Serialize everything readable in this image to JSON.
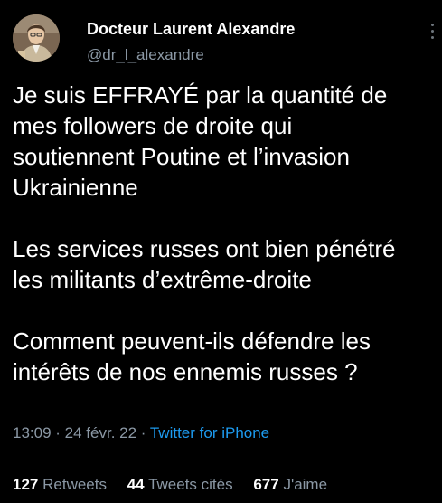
{
  "author": {
    "name": "Docteur Laurent Alexandre",
    "handle": "@dr_l_alexandre"
  },
  "tweet": {
    "paragraphs": [
      "Je suis EFFRAYÉ par la quantité de\nmes followers de droite qui\nsoutiennent Poutine et l’invasion\nUkrainienne",
      "Les services russes ont bien pénétré\nles militants d’extrême-droite",
      "Comment peuvent-ils défendre les\nintérêts de nos ennemis russes ?"
    ]
  },
  "meta": {
    "time": "13:09",
    "sep1": " · ",
    "date": "24 févr. 22",
    "sep2": " · ",
    "source": "Twitter for iPhone"
  },
  "stats": {
    "retweets_count": "127",
    "retweets_label": "Retweets",
    "quotes_count": "44",
    "quotes_label": "Tweets cités",
    "likes_count": "677",
    "likes_label": "J'aime"
  },
  "icons": {
    "more": "more-vertical-icon"
  },
  "colors": {
    "background": "#000000",
    "text": "#ffffff",
    "secondary": "#8b98a5",
    "link": "#1d9bf0",
    "divider": "#2f3336"
  }
}
